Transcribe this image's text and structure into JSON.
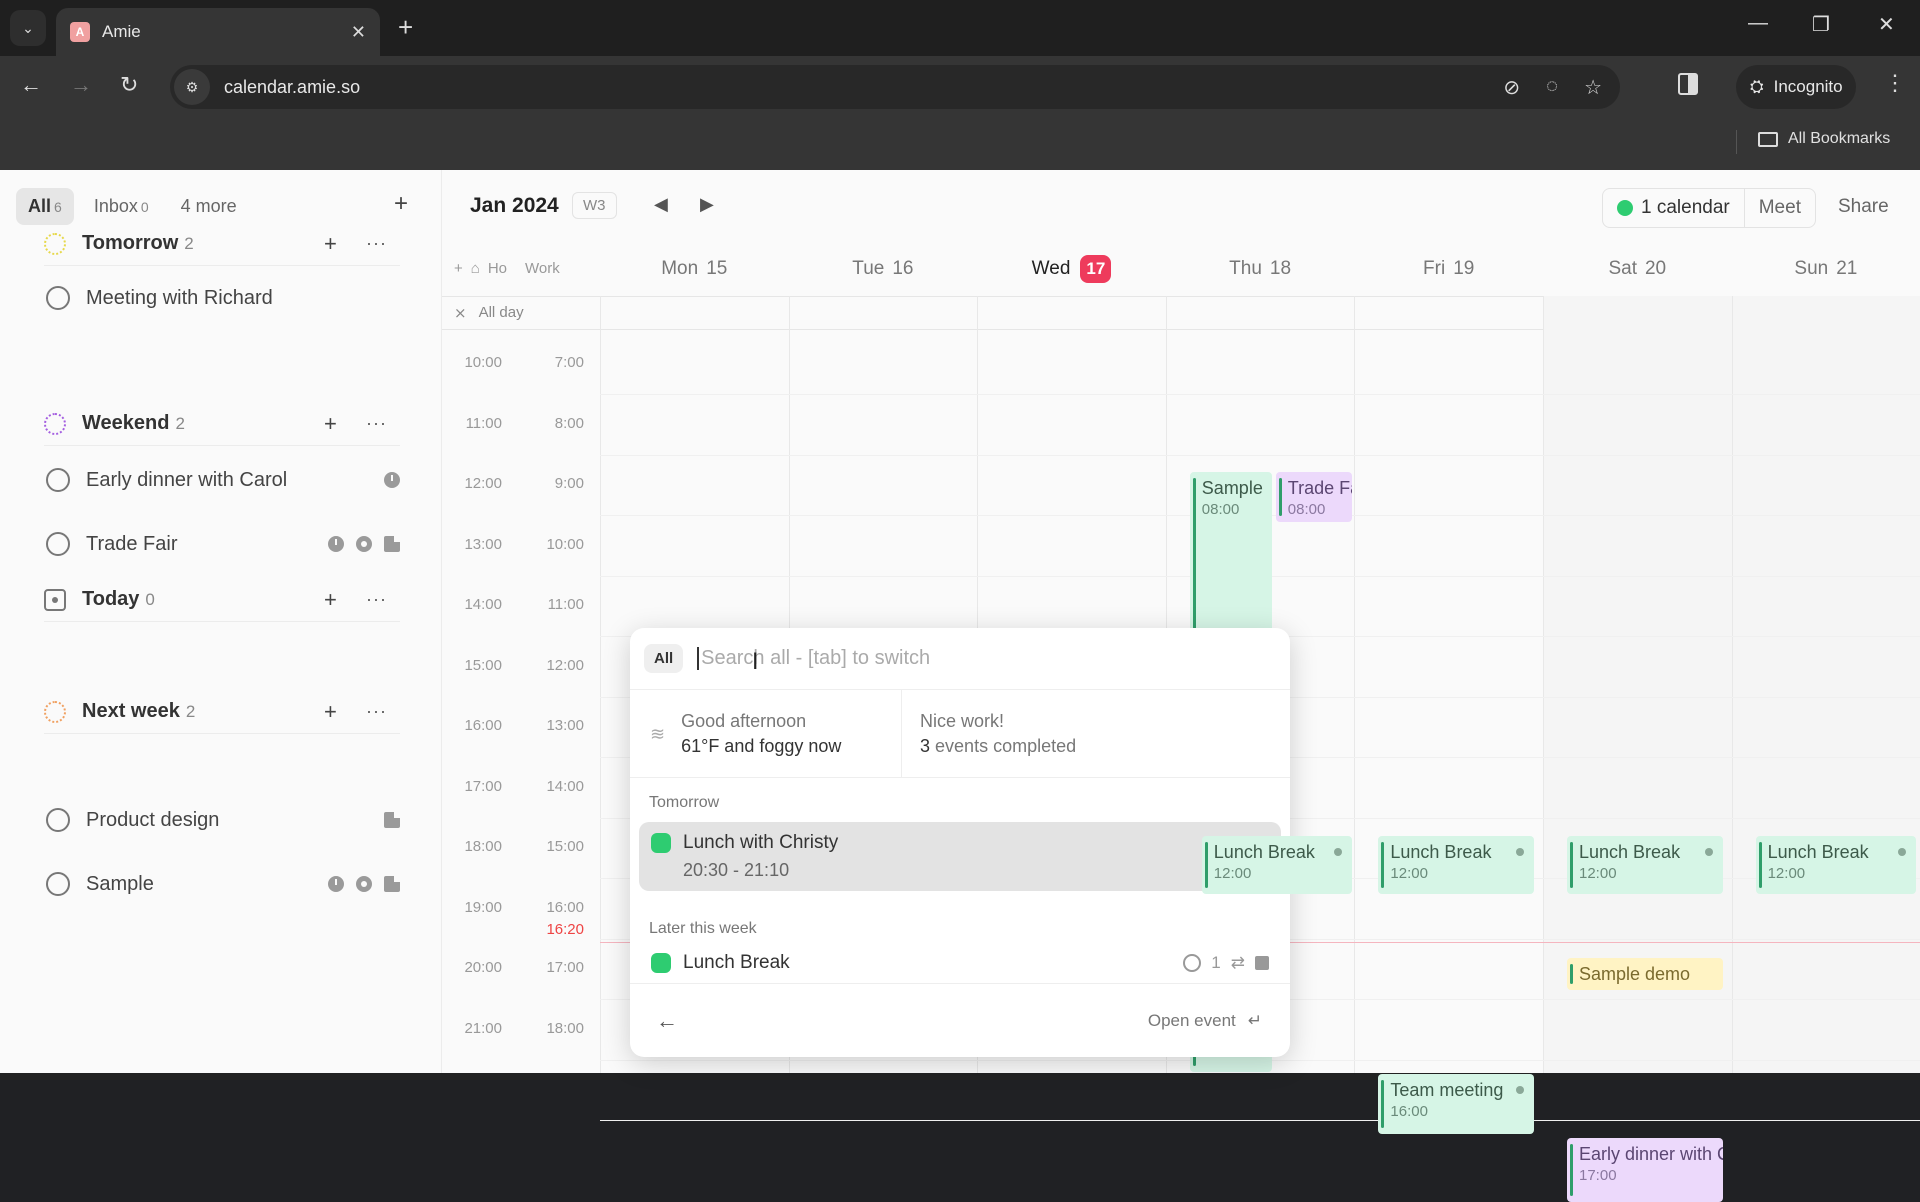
{
  "browser": {
    "tab_title": "Amie",
    "favicon_letter": "A",
    "url": "calendar.amie.so",
    "profile_label": "Incognito",
    "bookmarks_label": "All Bookmarks",
    "icons": {
      "tab_search": "chevron-down-icon",
      "close_tab": "✕",
      "new_tab": "+",
      "back": "←",
      "forward": "→",
      "reload": "↻",
      "site_info": "⚙",
      "minimize": "—",
      "restore": "❐",
      "close_window": "✕",
      "eye_off": "⊘",
      "track_off": "◌",
      "star": "☆",
      "incognito": "🕵",
      "menu": "⋮"
    }
  },
  "sidebar": {
    "tabs": [
      {
        "label": "All",
        "count": "6",
        "active": true
      },
      {
        "label": "Inbox",
        "count": "0"
      },
      {
        "label": "4 more",
        "count": ""
      }
    ],
    "add_label": "+",
    "groups": [
      {
        "title": "Tomorrow",
        "count": "2",
        "color": "#e6d84a",
        "tasks": [
          {
            "label": "Meeting with Richard",
            "icons": []
          }
        ]
      },
      {
        "title": "Weekend",
        "count": "2",
        "color": "#a45ee0",
        "tasks": [
          {
            "label": "Early dinner with Carol",
            "icons": [
              "clock"
            ]
          },
          {
            "label": "Trade Fair",
            "icons": [
              "clock",
              "ring",
              "doc"
            ]
          }
        ]
      },
      {
        "title": "Today",
        "count": "0",
        "tasks": []
      },
      {
        "title": "Next week",
        "count": "2",
        "color": "#f0a060",
        "tasks": [
          {
            "label": "Product design",
            "icons": [
              "doc"
            ]
          },
          {
            "label": "Sample",
            "icons": [
              "clock",
              "ring",
              "doc"
            ]
          }
        ]
      }
    ],
    "group_add": "+",
    "group_more": "···"
  },
  "calendar": {
    "month": "Jan 2024",
    "week": "W3",
    "prev": "◀",
    "next": "▶",
    "calendars_label": "1 calendar",
    "meet_label": "Meet",
    "share_label": "Share",
    "tz_add": "+",
    "tz_home": "Ho",
    "tz_work": "Work",
    "allday_label": "All day",
    "collapse_icon": "⨯",
    "days": [
      {
        "name": "Mon",
        "date": "15"
      },
      {
        "name": "Tue",
        "date": "16"
      },
      {
        "name": "Wed",
        "date": "17",
        "today": true
      },
      {
        "name": "Thu",
        "date": "18"
      },
      {
        "name": "Fri",
        "date": "19"
      },
      {
        "name": "Sat",
        "date": "20"
      },
      {
        "name": "Sun",
        "date": "21"
      }
    ],
    "hours_primary": [
      "10:00",
      "11:00",
      "12:00",
      "13:00",
      "14:00",
      "15:00",
      "16:00",
      "17:00",
      "18:00",
      "19:00",
      "20:00",
      "21:00"
    ],
    "hours_secondary": [
      "7:00",
      "8:00",
      "9:00",
      "10:00",
      "11:00",
      "12:00",
      "13:00",
      "14:00",
      "15:00",
      "16:00",
      "17:00",
      "18:00"
    ],
    "now_label": "16:20",
    "events": [
      {
        "title": "Sample",
        "time": "08:00",
        "color": "green"
      },
      {
        "title": "Trade Fair",
        "time": "08:00",
        "color": "purple"
      },
      {
        "title": "Lunch Break",
        "time": "12:00",
        "color": "green"
      },
      {
        "title": "Lunch Break",
        "time": "12:00",
        "color": "green"
      },
      {
        "title": "Lunch Break",
        "time": "12:00",
        "color": "green"
      },
      {
        "title": "Lunch Break",
        "time": "12:00",
        "color": "green"
      },
      {
        "title": "Sample demo",
        "time": "",
        "color": "yellow"
      },
      {
        "title": "Team meeting",
        "time": "16:00",
        "color": "green"
      },
      {
        "title": "Early dinner with Carol",
        "time": "17:00",
        "color": "purple"
      }
    ]
  },
  "popup": {
    "scope": "All",
    "search_value": "",
    "search_placeholder": "Search all - [tab] to switch",
    "greeting": "Good afternoon",
    "weather": "61°F and foggy now",
    "praise": "Nice work!",
    "completed_count": "3",
    "completed_text": "events completed",
    "sections": [
      {
        "label": "Tomorrow",
        "results": [
          {
            "title": "Lunch with Christy",
            "time": "20:30 - 21:10",
            "selected": true
          }
        ]
      },
      {
        "label": "Later this week",
        "results": [
          {
            "title": "Lunch Break",
            "attendees": "1",
            "recurring": true,
            "video": true
          }
        ]
      }
    ],
    "back_icon": "←",
    "open_event_label": "Open event",
    "enter_icon": "↵"
  },
  "colors": {
    "accent_green": "#2ecc71",
    "today_red": "#ee3b5c",
    "event_green": "#d6f5e6",
    "event_purple": "#ecd9fb",
    "event_yellow": "#fff3c4"
  }
}
